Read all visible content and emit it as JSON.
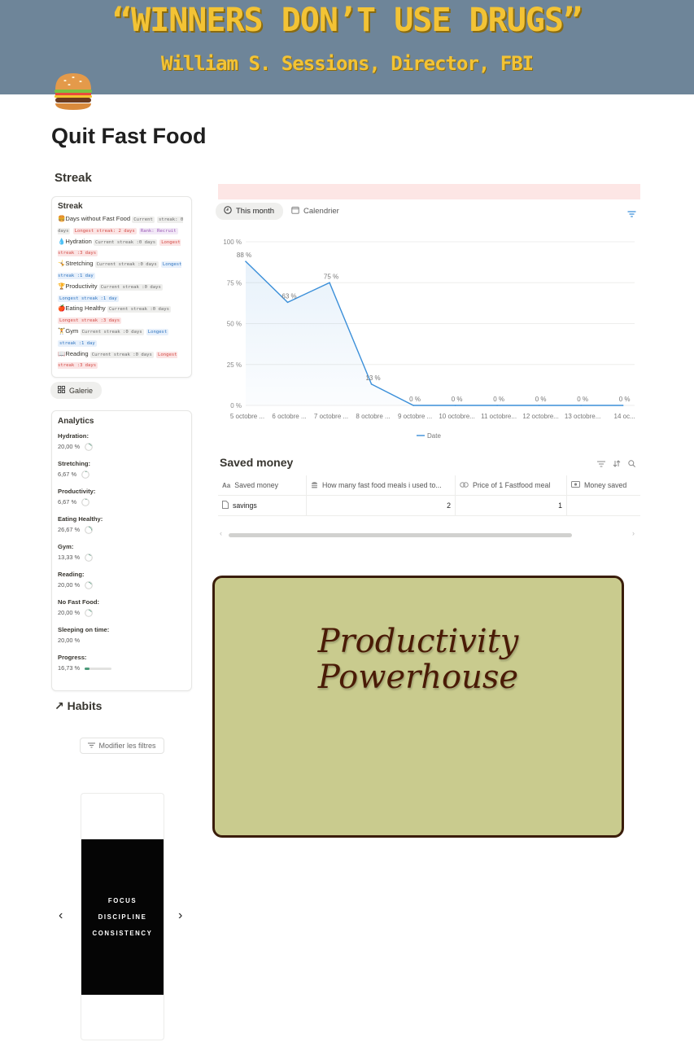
{
  "banner": {
    "quote": "“WINNERS DON’T USE DRUGS”",
    "attribution": "William S. Sessions, Director, FBI"
  },
  "page": {
    "title": "Quit Fast Food",
    "icon": "burger-icon"
  },
  "streak_section": {
    "title": "Streak",
    "card_title": "Streak",
    "items": [
      {
        "emoji": "🍔",
        "name": "Days without Fast Food",
        "tags": [
          {
            "t": "Current",
            "c": "tg"
          },
          {
            "t": "streak: 0 days",
            "c": "tg"
          },
          {
            "t": "Longest streak: 2 days",
            "c": "tr"
          },
          {
            "t": "Rank: Recruit",
            "c": "tp"
          }
        ]
      },
      {
        "emoji": "💧",
        "name": "Hydration",
        "tags": [
          {
            "t": "Current streak :0 days",
            "c": "tg"
          },
          {
            "t": "Longest  streak :3 days",
            "c": "tr"
          }
        ]
      },
      {
        "emoji": "🤸",
        "name": "Stretching",
        "tags": [
          {
            "t": "Current streak :0 days",
            "c": "tg"
          },
          {
            "t": "Longest  streak :1 day",
            "c": "tb"
          }
        ]
      },
      {
        "emoji": "🏆",
        "name": "Productivity",
        "tags": [
          {
            "t": "Current streak :0 days",
            "c": "tg"
          },
          {
            "t": "Longest  streak :1 day",
            "c": "tb"
          }
        ]
      },
      {
        "emoji": "🍎",
        "name": "Eating Healthy",
        "tags": [
          {
            "t": "Current streak :0 days",
            "c": "tg"
          },
          {
            "t": "Longest  streak :3 days",
            "c": "tr"
          }
        ]
      },
      {
        "emoji": "🏋",
        "name": "Gym",
        "tags": [
          {
            "t": "Current streak :0 days",
            "c": "tg"
          },
          {
            "t": "Longest",
            "c": "tb"
          },
          {
            "t": "streak :1 day",
            "c": "tb"
          }
        ]
      },
      {
        "emoji": "📖",
        "name": "Reading",
        "tags": [
          {
            "t": "Current streak :0 days",
            "c": "tg"
          },
          {
            "t": "Longest  streak :3 days",
            "c": "tr"
          }
        ]
      }
    ]
  },
  "galerie_label": "Galerie",
  "analytics": {
    "title": "Analytics",
    "items": [
      {
        "label": "Hydration:",
        "value": "20,00 %",
        "pct": 20,
        "kind": "ring"
      },
      {
        "label": "Stretching:",
        "value": "6,67 %",
        "pct": 6.67,
        "kind": "ring"
      },
      {
        "label": "Productivity:",
        "value": "6,67 %",
        "pct": 6.67,
        "kind": "ring"
      },
      {
        "label": "Eating Healthy:",
        "value": "26,67 %",
        "pct": 26.67,
        "kind": "ring"
      },
      {
        "label": "Gym:",
        "value": "13,33 %",
        "pct": 13.33,
        "kind": "ring"
      },
      {
        "label": "Reading:",
        "value": "20,00 %",
        "pct": 20,
        "kind": "ring"
      },
      {
        "label": "No Fast Food:",
        "value": "20,00 %",
        "pct": 20,
        "kind": "ring"
      },
      {
        "label": "Sleeping on time:",
        "value": "20,00 %",
        "pct": 20,
        "kind": "none"
      },
      {
        "label": "Progress:",
        "value": "16,73 %",
        "pct": 16.73,
        "kind": "bar"
      }
    ]
  },
  "habits": {
    "title": "Habits",
    "filter_label": "Modifier les filtres",
    "card_words": [
      "FOCUS",
      "DISCIPLINE",
      "CONSISTENCY"
    ]
  },
  "tabs": {
    "active": "This month",
    "other": "Calendrier"
  },
  "chart_data": {
    "type": "area",
    "x": [
      "5 octobre ...",
      "6 octobre ...",
      "7 octobre ...",
      "8 octobre ...",
      "9 octobre ...",
      "10 octobre...",
      "11 octobre...",
      "12 octobre...",
      "13 octobre...",
      "14 oc..."
    ],
    "series": [
      {
        "name": "Date",
        "values": [
          88,
          63,
          75,
          13,
          0,
          0,
          0,
          0,
          0,
          0
        ]
      }
    ],
    "data_labels": [
      "88 %",
      "63 %",
      "75 %",
      "13 %",
      "0 %",
      "0 %",
      "0 %",
      "0 %",
      "0 %",
      "0 %"
    ],
    "yticks": [
      "100 %",
      "75 %",
      "50 %",
      "25 %",
      "0 %"
    ],
    "ylim": [
      0,
      100
    ],
    "color": "#3b8fd9",
    "legend": "bottom"
  },
  "saved_money": {
    "title": "Saved money",
    "columns": [
      {
        "icon": "text-icon",
        "label": "Saved money"
      },
      {
        "icon": "burger-icon",
        "label": "How many fast food meals i used to..."
      },
      {
        "icon": "formula-icon",
        "label": "Price of 1 Fastfood meal"
      },
      {
        "icon": "money-icon",
        "label": "Money saved"
      }
    ],
    "rows": [
      [
        "savings",
        "2",
        "1",
        ""
      ]
    ]
  },
  "quote_card": {
    "line1": "Productivity",
    "line2": "Powerhouse"
  }
}
